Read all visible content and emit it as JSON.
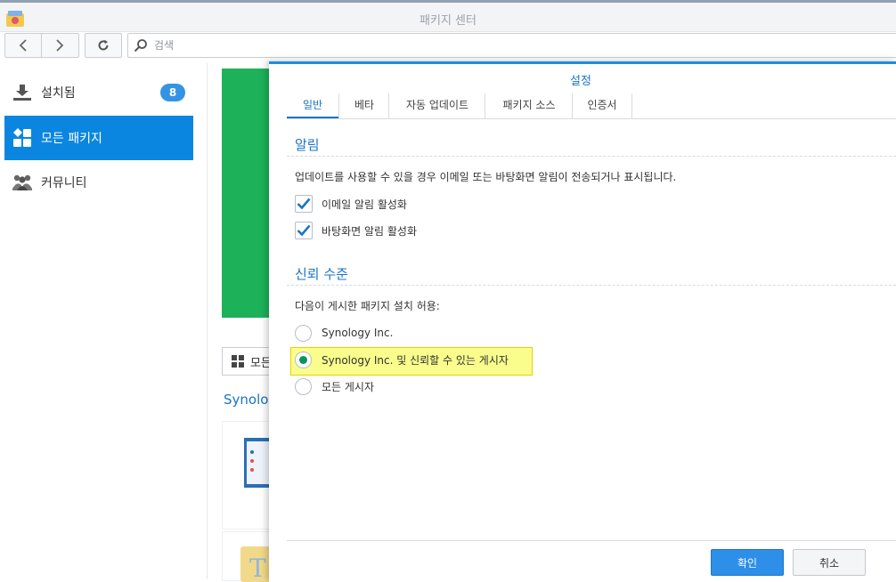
{
  "window": {
    "title": "패키지 센터"
  },
  "toolbar": {
    "search_placeholder": "검색"
  },
  "sidebar": {
    "items": [
      {
        "label": "설치됨",
        "badge": "8",
        "icon": "download-icon"
      },
      {
        "label": "모든 패키지",
        "icon": "grid-icon",
        "active": true
      },
      {
        "label": "커뮤니티",
        "icon": "community-icon"
      }
    ]
  },
  "main": {
    "filter_label": "모든",
    "section_heading": "Synolo"
  },
  "dialog": {
    "title": "설정",
    "tabs": [
      {
        "label": "일반",
        "active": true
      },
      {
        "label": "베타"
      },
      {
        "label": "자동 업데이트"
      },
      {
        "label": "패키지 소스"
      },
      {
        "label": "인증서"
      }
    ],
    "alerts": {
      "heading": "알림",
      "description": "업데이트를 사용할 수 있을 경우 이메일 또는 바탕화면 알림이 전송되거나 표시됩니다.",
      "options": [
        {
          "label": "이메일 알림 활성화",
          "checked": true
        },
        {
          "label": "바탕화면 알림 활성화",
          "checked": true
        }
      ]
    },
    "trust": {
      "heading": "신뢰 수준",
      "description": "다음이 게시한 패키지 설치 허용:",
      "options": [
        {
          "label": "Synology Inc.",
          "selected": false
        },
        {
          "label": "Synology Inc. 및 신뢰할 수 있는 게시자",
          "selected": true
        },
        {
          "label": "모든 게시자",
          "selected": false
        }
      ]
    },
    "buttons": {
      "ok": "확인",
      "cancel": "취소"
    }
  },
  "colors": {
    "accent": "#1a74c5",
    "primary_button": "#2d8fe8",
    "active_sidebar": "#0a86e0",
    "radio_selected": "#07955b",
    "highlight": "#fafc8c"
  }
}
